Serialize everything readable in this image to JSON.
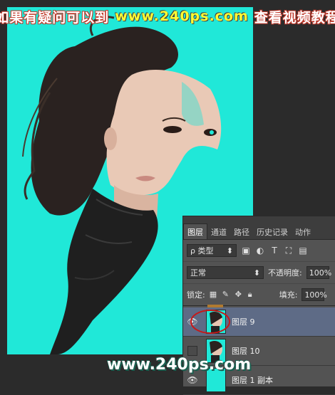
{
  "watermark": {
    "left": "如果有疑问可以到",
    "site": "www.240ps.com",
    "right": "查看视频教程",
    "bottom": "www.240ps.com"
  },
  "panel": {
    "tabs": [
      "图层",
      "通道",
      "路径",
      "历史记录",
      "动作"
    ],
    "filter_label": "ρ 类型",
    "blend_mode": "正常",
    "opacity_label": "不透明度:",
    "opacity_value": "100%",
    "lock_label": "锁定:",
    "fill_label": "填充:",
    "fill_value": "100%",
    "layers": [
      {
        "name": "图层 9",
        "selected": true,
        "visible": true
      },
      {
        "name": "图层 10",
        "selected": false,
        "visible": false
      },
      {
        "name": "图层 1 副本",
        "selected": false,
        "visible": true
      }
    ]
  },
  "colors": {
    "canvas_bg": "#20e8d8",
    "selected_row": "#5e6b86",
    "accent_red": "#c81818"
  }
}
